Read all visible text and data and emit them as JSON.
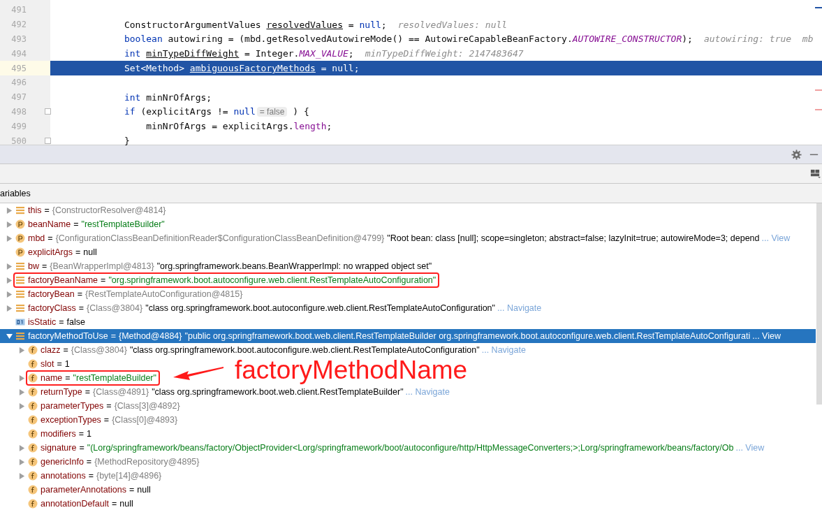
{
  "editor": {
    "lines": [
      {
        "number": "491",
        "selected": false,
        "fold": false
      },
      {
        "number": "492",
        "selected": false,
        "fold": false,
        "tokens": [
          {
            "kind": "plain",
            "text": "            ConstructorArgumentValues "
          },
          {
            "kind": "var",
            "text": "resolvedValues"
          },
          {
            "kind": "plain",
            "text": " = "
          },
          {
            "kind": "kw",
            "text": "null"
          },
          {
            "kind": "plain",
            "text": ";"
          },
          {
            "kind": "hint",
            "text": "resolvedValues: null"
          }
        ]
      },
      {
        "number": "493",
        "selected": false,
        "fold": false,
        "tokens": [
          {
            "kind": "kw",
            "text": "            boolean"
          },
          {
            "kind": "plain",
            "text": " autowiring = (mbd.getResolvedAutowireMode() == AutowireCapableBeanFactory."
          },
          {
            "kind": "const",
            "text": "AUTOWIRE_CONSTRUCTOR"
          },
          {
            "kind": "plain",
            "text": ");"
          },
          {
            "kind": "hint",
            "text": "autowiring: true  mb"
          }
        ]
      },
      {
        "number": "494",
        "selected": false,
        "fold": false,
        "tokens": [
          {
            "kind": "kw",
            "text": "            int "
          },
          {
            "kind": "var",
            "text": "minTypeDiffWeight"
          },
          {
            "kind": "plain",
            "text": " = Integer."
          },
          {
            "kind": "const",
            "text": "MAX_VALUE"
          },
          {
            "kind": "plain",
            "text": ";"
          },
          {
            "kind": "hint",
            "text": "minTypeDiffWeight: 2147483647"
          }
        ]
      },
      {
        "number": "495",
        "selected": true,
        "fold": false,
        "tokens": [
          {
            "kind": "plain",
            "text": "            Set<Method> "
          },
          {
            "kind": "var",
            "text": "ambiguousFactoryMethods"
          },
          {
            "kind": "plain",
            "text": " = "
          },
          {
            "kind": "kw",
            "text": "null"
          },
          {
            "kind": "plain",
            "text": ";"
          }
        ]
      },
      {
        "number": "496",
        "selected": false,
        "fold": false
      },
      {
        "number": "497",
        "selected": false,
        "fold": false,
        "tokens": [
          {
            "kind": "kw",
            "text": "            int"
          },
          {
            "kind": "plain",
            "text": " minNrOfArgs;"
          }
        ]
      },
      {
        "number": "498",
        "selected": false,
        "fold": true,
        "tokens": [
          {
            "kind": "kw",
            "text": "            if"
          },
          {
            "kind": "plain",
            "text": " (explicitArgs != "
          },
          {
            "kind": "kw",
            "text": "null"
          },
          {
            "kind": "inline",
            "text": "= false"
          },
          {
            "kind": "plain",
            "text": " ) {"
          }
        ]
      },
      {
        "number": "499",
        "selected": false,
        "fold": false,
        "tokens": [
          {
            "kind": "plain",
            "text": "                minNrOfArgs = explicitArgs."
          },
          {
            "kind": "field",
            "text": "length"
          },
          {
            "kind": "plain",
            "text": ";"
          }
        ]
      },
      {
        "number": "500",
        "selected": false,
        "fold": true,
        "tokens": [
          {
            "kind": "plain",
            "text": "            }"
          }
        ]
      }
    ]
  },
  "variables_panel": {
    "title": "ariables",
    "rows": [
      {
        "kind": "local",
        "expandable": true,
        "expanded": false,
        "selected": false,
        "boxed": false,
        "name": "this",
        "equals": "=",
        "value": [
          {
            "kind": "ref",
            "text": "{ConstructorResolver@4814}"
          }
        ]
      },
      {
        "kind": "param",
        "expandable": true,
        "expanded": false,
        "selected": false,
        "boxed": false,
        "name": "beanName",
        "equals": "=",
        "value": [
          {
            "kind": "string",
            "text": "\"restTemplateBuilder\""
          }
        ]
      },
      {
        "kind": "param",
        "expandable": true,
        "expanded": false,
        "selected": false,
        "boxed": false,
        "name": "mbd",
        "equals": "=",
        "value": [
          {
            "kind": "ref",
            "text": "{ConfigurationClassBeanDefinitionReader$ConfigurationClassBeanDefinition@4799}"
          },
          {
            "kind": "text",
            "text": "\"Root bean: class [null]; scope=singleton; abstract=false; lazyInit=true; autowireMode=3; depend"
          }
        ],
        "link": "... View"
      },
      {
        "kind": "param",
        "expandable": false,
        "selected": false,
        "boxed": false,
        "name": "explicitArgs",
        "equals": "=",
        "value": [
          {
            "kind": "plain",
            "text": "null"
          }
        ]
      },
      {
        "kind": "local",
        "expandable": true,
        "expanded": false,
        "selected": false,
        "boxed": false,
        "name": "bw",
        "equals": "=",
        "value": [
          {
            "kind": "ref",
            "text": "{BeanWrapperImpl@4813}"
          },
          {
            "kind": "text",
            "text": "\"org.springframework.beans.BeanWrapperImpl: no wrapped object set\""
          }
        ]
      },
      {
        "kind": "local",
        "expandable": true,
        "expanded": false,
        "selected": false,
        "boxed": true,
        "name": "factoryBeanName",
        "equals": "=",
        "value": [
          {
            "kind": "string",
            "text": "\"org.springframework.boot.autoconfigure.web.client.RestTemplateAutoConfiguration\""
          }
        ]
      },
      {
        "kind": "local",
        "expandable": true,
        "expanded": false,
        "selected": false,
        "boxed": false,
        "name": "factoryBean",
        "equals": "=",
        "value": [
          {
            "kind": "ref",
            "text": "{RestTemplateAutoConfiguration@4815}"
          }
        ]
      },
      {
        "kind": "local",
        "expandable": true,
        "expanded": false,
        "selected": false,
        "boxed": false,
        "name": "factoryClass",
        "equals": "=",
        "value": [
          {
            "kind": "ref",
            "text": "{Class@3804}"
          },
          {
            "kind": "text",
            "text": "\"class org.springframework.boot.autoconfigure.web.client.RestTemplateAutoConfiguration\""
          }
        ],
        "link": "... Navigate"
      },
      {
        "kind": "primitive",
        "expandable": false,
        "selected": false,
        "boxed": false,
        "name": "isStatic",
        "equals": "=",
        "value": [
          {
            "kind": "plain",
            "text": "false"
          }
        ]
      },
      {
        "kind": "local",
        "expandable": true,
        "expanded": true,
        "selected": true,
        "boxed": false,
        "name": "factoryMethodToUse",
        "equals": "=",
        "value": [
          {
            "kind": "ref",
            "text": "{Method@4884}"
          },
          {
            "kind": "text",
            "text": "\"public org.springframework.boot.web.client.RestTemplateBuilder org.springframework.boot.autoconfigure.web.client.RestTemplateAutoConfigurati"
          }
        ],
        "link": "... View",
        "children": [
          {
            "kind": "field",
            "expandable": true,
            "expanded": false,
            "selected": false,
            "boxed": false,
            "name": "clazz",
            "equals": "=",
            "value": [
              {
                "kind": "ref",
                "text": "{Class@3804}"
              },
              {
                "kind": "text",
                "text": "\"class org.springframework.boot.autoconfigure.web.client.RestTemplateAutoConfiguration\""
              }
            ],
            "link": "... Navigate"
          },
          {
            "kind": "field",
            "expandable": false,
            "selected": false,
            "boxed": false,
            "name": "slot",
            "equals": "=",
            "value": [
              {
                "kind": "plain",
                "text": "1"
              }
            ]
          },
          {
            "kind": "field",
            "expandable": true,
            "expanded": false,
            "selected": false,
            "boxed": true,
            "name": "name",
            "equals": "=",
            "value": [
              {
                "kind": "string",
                "text": "\"restTemplateBuilder\""
              }
            ]
          },
          {
            "kind": "field",
            "expandable": true,
            "expanded": false,
            "selected": false,
            "boxed": false,
            "name": "returnType",
            "equals": "=",
            "value": [
              {
                "kind": "ref",
                "text": "{Class@4891}"
              },
              {
                "kind": "text",
                "text": "\"class org.springframework.boot.web.client.RestTemplateBuilder\""
              }
            ],
            "link": "... Navigate"
          },
          {
            "kind": "field",
            "expandable": true,
            "expanded": false,
            "selected": false,
            "boxed": false,
            "name": "parameterTypes",
            "equals": "=",
            "value": [
              {
                "kind": "ref",
                "text": "{Class[3]@4892}"
              }
            ]
          },
          {
            "kind": "field",
            "expandable": false,
            "selected": false,
            "boxed": false,
            "name": "exceptionTypes",
            "equals": "=",
            "value": [
              {
                "kind": "ref",
                "text": "{Class[0]@4893}"
              }
            ]
          },
          {
            "kind": "field",
            "expandable": false,
            "selected": false,
            "boxed": false,
            "name": "modifiers",
            "equals": "=",
            "value": [
              {
                "kind": "plain",
                "text": "1"
              }
            ]
          },
          {
            "kind": "field",
            "expandable": true,
            "expanded": false,
            "selected": false,
            "boxed": false,
            "name": "signature",
            "equals": "=",
            "value": [
              {
                "kind": "string",
                "text": "\"(Lorg/springframework/beans/factory/ObjectProvider<Lorg/springframework/boot/autoconfigure/http/HttpMessageConverters;>;Lorg/springframework/beans/factory/Ob"
              }
            ],
            "link": "... View"
          },
          {
            "kind": "field",
            "expandable": true,
            "expanded": false,
            "selected": false,
            "boxed": false,
            "name": "genericInfo",
            "equals": "=",
            "value": [
              {
                "kind": "ref",
                "text": "{MethodRepository@4895}"
              }
            ]
          },
          {
            "kind": "field",
            "expandable": true,
            "expanded": false,
            "selected": false,
            "boxed": false,
            "name": "annotations",
            "equals": "=",
            "value": [
              {
                "kind": "ref",
                "text": "{byte[14]@4896}"
              }
            ]
          },
          {
            "kind": "field",
            "expandable": false,
            "selected": false,
            "boxed": false,
            "name": "parameterAnnotations",
            "equals": "=",
            "value": [
              {
                "kind": "plain",
                "text": "null"
              }
            ]
          },
          {
            "kind": "field",
            "expandable": false,
            "selected": false,
            "boxed": false,
            "name": "annotationDefault",
            "equals": "=",
            "value": [
              {
                "kind": "plain",
                "text": "null"
              }
            ]
          }
        ]
      }
    ]
  },
  "annotation": {
    "text": "factoryMethodName"
  }
}
